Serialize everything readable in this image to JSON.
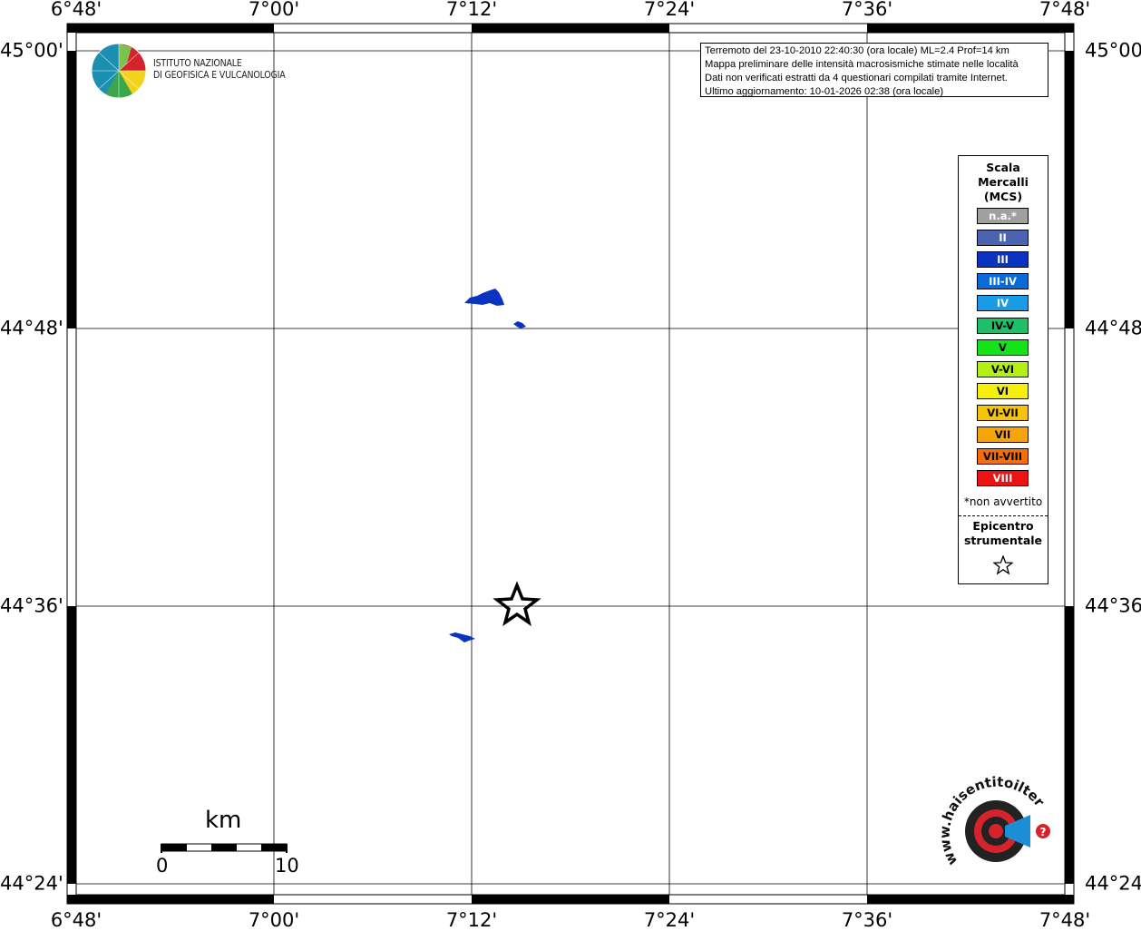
{
  "map": {
    "lon_labels": [
      "6°48'",
      "7°00'",
      "7°12'",
      "7°24'",
      "7°36'",
      "7°48'"
    ],
    "lat_labels": [
      "45°00'",
      "44°48'",
      "44°36'",
      "44°24'"
    ],
    "info_lines": [
      "Terremoto del 23-10-2010 22:40:30 (ora locale) ML=2.4 Prof=14 km",
      "Mappa preliminare delle intensità macrosismiche stimate nelle località",
      "Dati non verificati estratti da 4 questionari compilati tramite Internet.",
      "Ultimo aggiornamento: 10-01-2026 02:38 (ora locale)"
    ],
    "ingv_name": [
      "ISTITUTO NAZIONALE",
      "DI GEOFISICA E VULCANOLOGIA"
    ],
    "scale": {
      "unit": "km",
      "start": "0",
      "end": "10"
    },
    "hsit_logo_text": "www.haisentitoilterremoto.it"
  },
  "legend": {
    "title": [
      "Scala",
      "Mercalli",
      "(MCS)"
    ],
    "items": [
      {
        "label": "n.a.*",
        "color": "#a0a0a0",
        "text_color": "#ffffff"
      },
      {
        "label": "II",
        "color": "#4a64b0",
        "text_color": "#ffffff"
      },
      {
        "label": "III",
        "color": "#0a33c2",
        "text_color": "#ffffff"
      },
      {
        "label": "III-IV",
        "color": "#0a6ad6",
        "text_color": "#ffffff"
      },
      {
        "label": "IV",
        "color": "#1a9be6",
        "text_color": "#ffffff"
      },
      {
        "label": "IV-V",
        "color": "#1fbf6a",
        "text_color": "#000000"
      },
      {
        "label": "V",
        "color": "#15e31a",
        "text_color": "#000000"
      },
      {
        "label": "V-VI",
        "color": "#b4f014",
        "text_color": "#000000"
      },
      {
        "label": "VI",
        "color": "#f5f00a",
        "text_color": "#000000"
      },
      {
        "label": "VI-VII",
        "color": "#f5c40a",
        "text_color": "#000000"
      },
      {
        "label": "VII",
        "color": "#f5a50a",
        "text_color": "#000000"
      },
      {
        "label": "VII-VIII",
        "color": "#f56e0a",
        "text_color": "#000000"
      },
      {
        "label": "VIII",
        "color": "#ee1212",
        "text_color": "#ffffff"
      }
    ],
    "note": "*non avvertito",
    "epicenter_title": [
      "Epicentro",
      "strumentale"
    ]
  }
}
